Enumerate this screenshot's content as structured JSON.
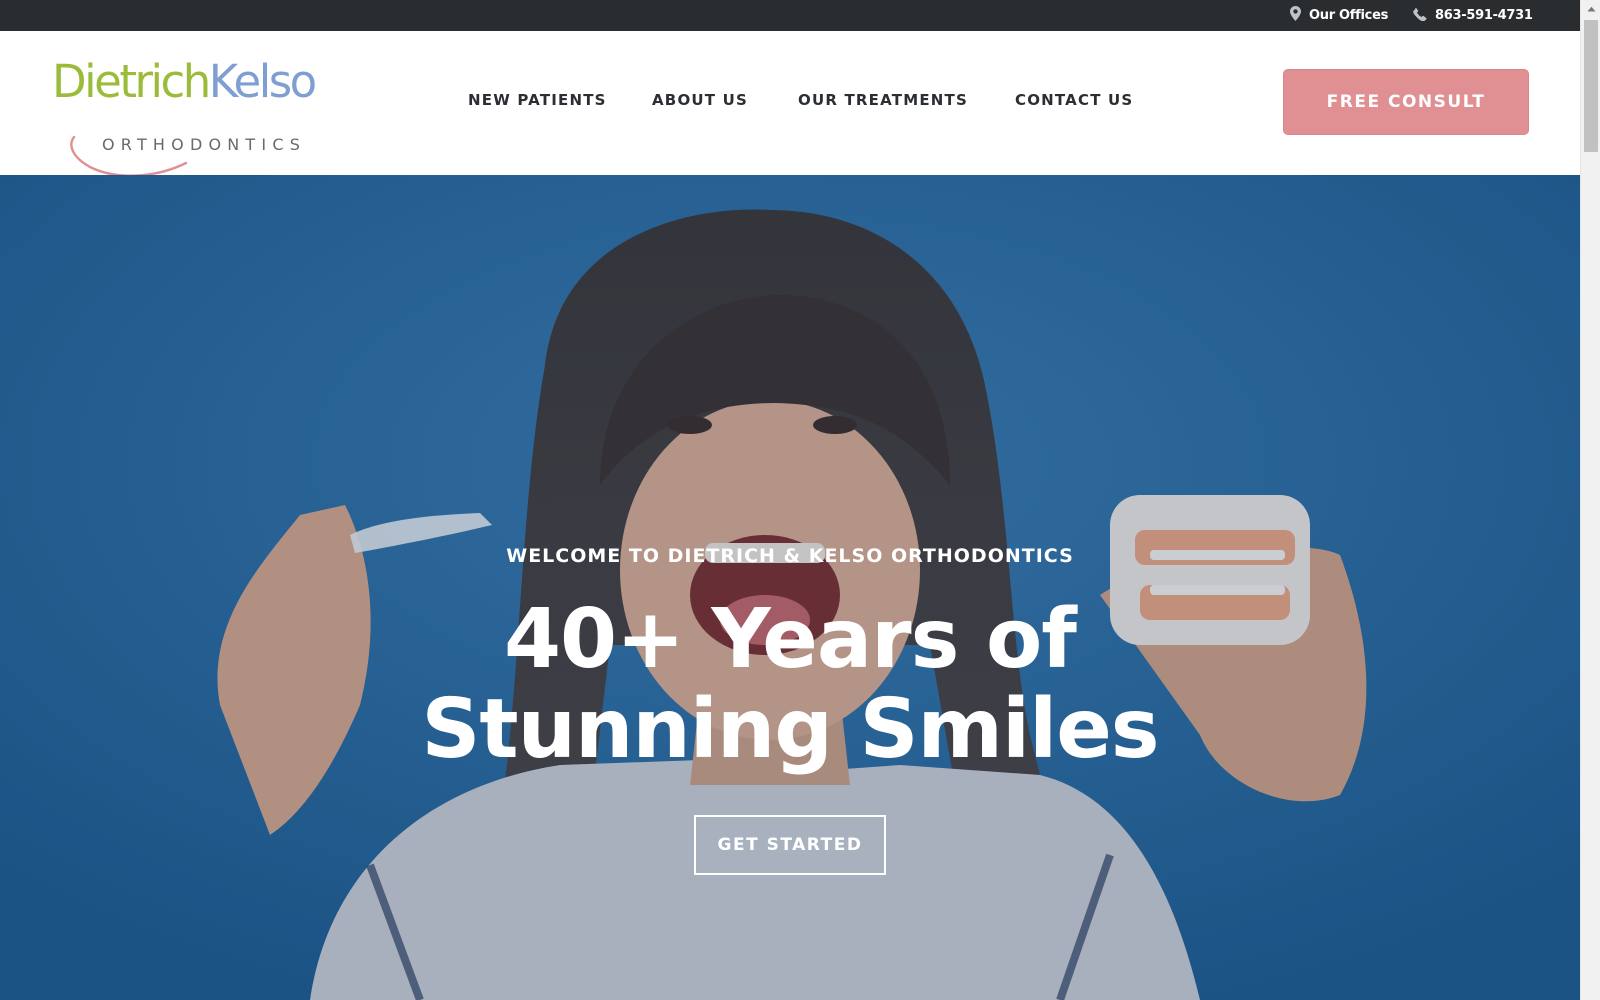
{
  "topbar": {
    "offices_label": "Our Offices",
    "offices_icon": "map-pin-icon",
    "phone_label": "863-591-4731",
    "phone_icon": "phone-icon"
  },
  "brand": {
    "name_part1": "Dietrich",
    "name_part2": "Kelso",
    "subtitle": "ORTHODONTICS",
    "color_green": "#9bbc3b",
    "color_blue": "#7e9fd0",
    "color_smile": "#e09093"
  },
  "nav": {
    "items": [
      {
        "label": "NEW PATIENTS"
      },
      {
        "label": "ABOUT US"
      },
      {
        "label": "OUR TREATMENTS"
      },
      {
        "label": "CONTACT US"
      }
    ],
    "cta_label": "FREE CONSULT",
    "cta_color": "#e09093"
  },
  "hero": {
    "eyebrow": "WELCOME TO DIETRICH & KELSO ORTHODONTICS",
    "title_line1": "40+ Years of",
    "title_line2": "Stunning Smiles",
    "button_label": "GET STARTED",
    "background_color": "#24679f"
  }
}
